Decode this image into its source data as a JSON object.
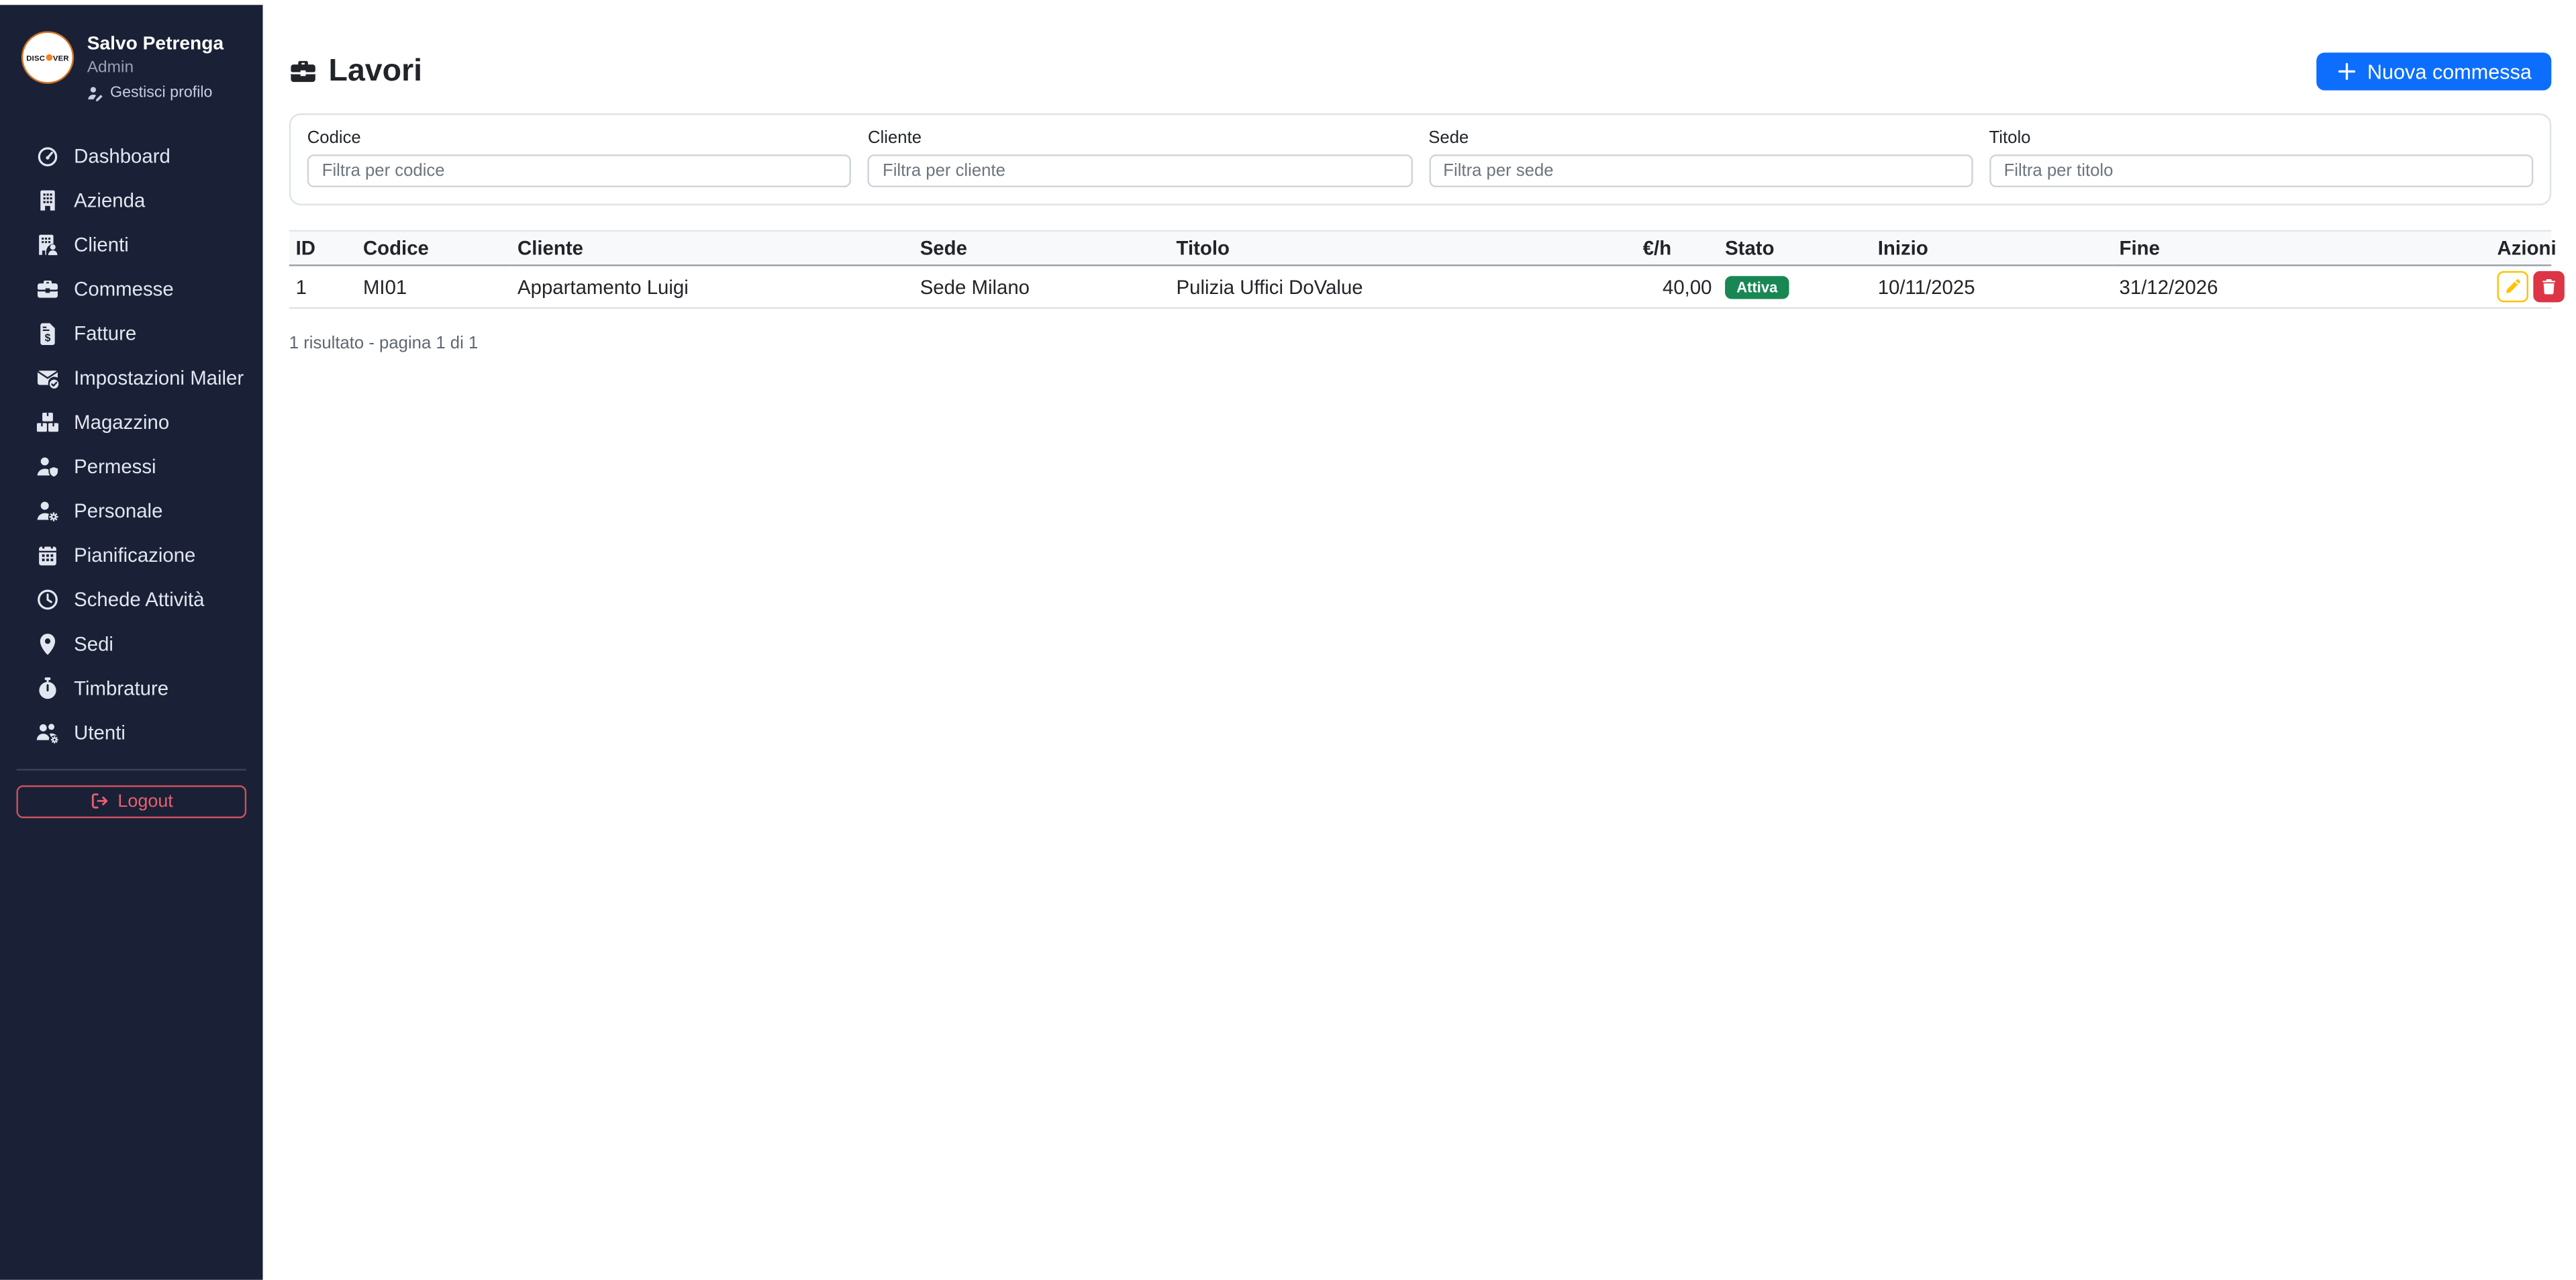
{
  "brand": {
    "logo_part1": "DISC",
    "logo_part2": "VER"
  },
  "user": {
    "name": "Salvo Petrenga",
    "role": "Admin",
    "profile_link": "Gestisci profilo"
  },
  "sidebar": {
    "items": [
      {
        "label": "Dashboard",
        "icon": "gauge-icon"
      },
      {
        "label": "Azienda",
        "icon": "building-icon"
      },
      {
        "label": "Clienti",
        "icon": "building-user-icon"
      },
      {
        "label": "Commesse",
        "icon": "briefcase-icon"
      },
      {
        "label": "Fatture",
        "icon": "invoice-dollar-icon"
      },
      {
        "label": "Impostazioni Mailer",
        "icon": "envelope-check-icon"
      },
      {
        "label": "Magazzino",
        "icon": "boxes-icon"
      },
      {
        "label": "Permessi",
        "icon": "user-shield-icon"
      },
      {
        "label": "Personale",
        "icon": "user-gear-icon"
      },
      {
        "label": "Pianificazione",
        "icon": "calendar-icon"
      },
      {
        "label": "Schede Attività",
        "icon": "clock-icon"
      },
      {
        "label": "Sedi",
        "icon": "map-pin-icon"
      },
      {
        "label": "Timbrature",
        "icon": "stopwatch-icon"
      },
      {
        "label": "Utenti",
        "icon": "users-gear-icon"
      }
    ],
    "logout_label": "Logout"
  },
  "header": {
    "title": "Lavori",
    "title_icon": "briefcase-icon",
    "new_button_label": "Nuova commessa"
  },
  "filters": {
    "fields": [
      {
        "label": "Codice",
        "placeholder": "Filtra per codice",
        "value": ""
      },
      {
        "label": "Cliente",
        "placeholder": "Filtra per cliente",
        "value": ""
      },
      {
        "label": "Sede",
        "placeholder": "Filtra per sede",
        "value": ""
      },
      {
        "label": "Titolo",
        "placeholder": "Filtra per titolo",
        "value": ""
      }
    ]
  },
  "table": {
    "columns": [
      "ID",
      "Codice",
      "Cliente",
      "Sede",
      "Titolo",
      "€/h",
      "Stato",
      "Inizio",
      "Fine",
      "Azioni"
    ],
    "rows": [
      {
        "id": "1",
        "codice": "MI01",
        "cliente": "Appartamento Luigi",
        "sede": "Sede Milano",
        "titolo": "Pulizia Uffici DoValue",
        "rate": "40,00",
        "stato": "Attiva",
        "inizio": "10/11/2025",
        "fine": "31/12/2026"
      }
    ],
    "summary": "1 risultato - pagina 1 di 1"
  },
  "colors": {
    "sidebar_bg": "#1a2136",
    "primary": "#0d6efd",
    "success": "#198754",
    "danger": "#dc3545",
    "warning": "#ffc107",
    "logout": "#ea5f6e"
  }
}
